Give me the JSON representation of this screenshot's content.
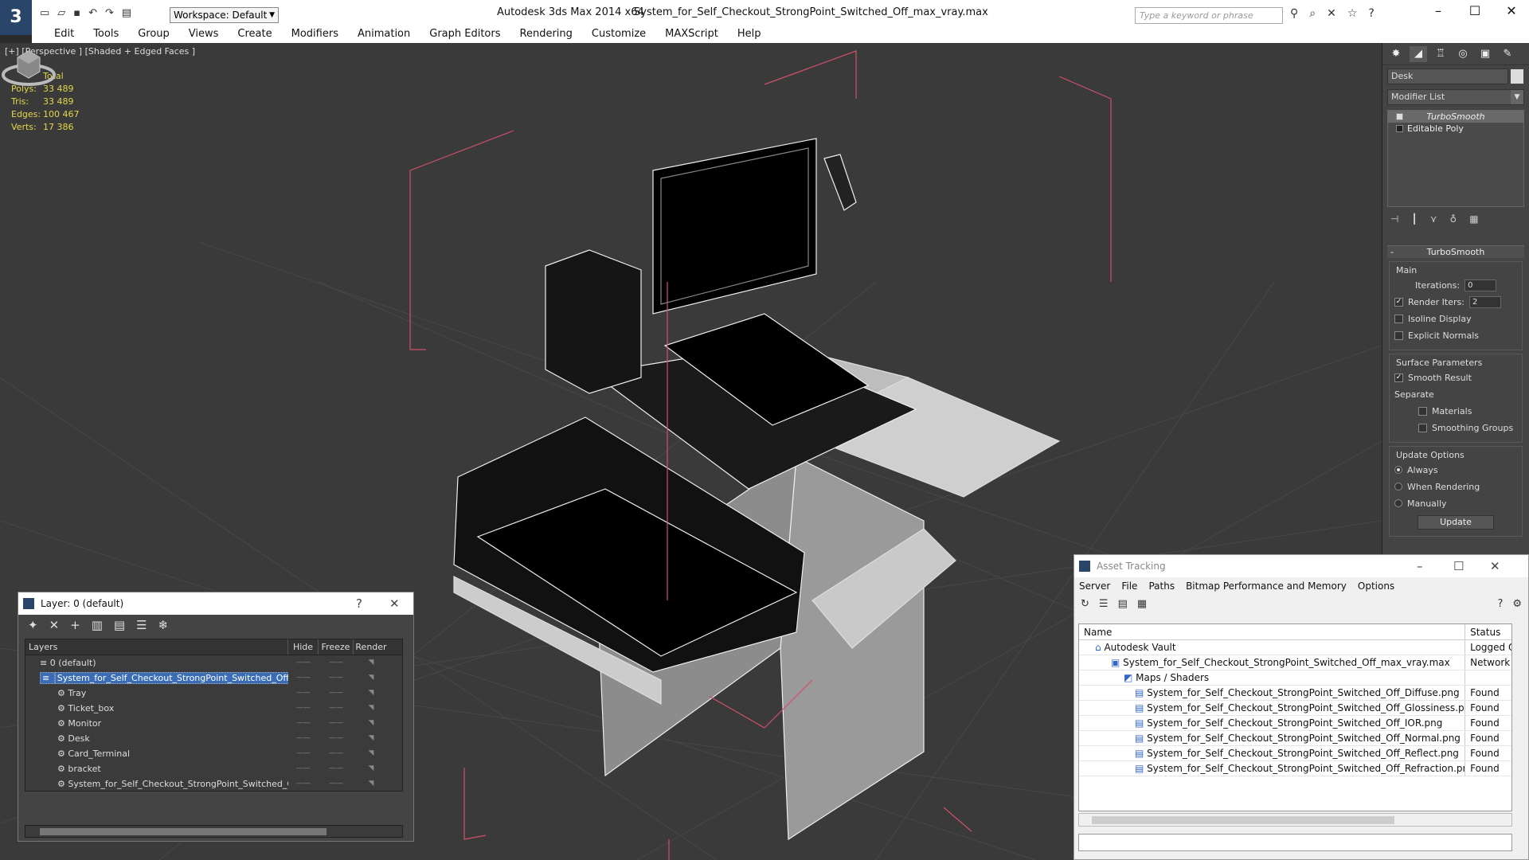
{
  "app": {
    "title": "Autodesk 3ds Max  2014 x64",
    "file": "System_for_Self_Checkout_StrongPoint_Switched_Off_max_vray.max",
    "workspace": "Workspace: Default",
    "search_placeholder": "Type a keyword or phrase"
  },
  "menu": [
    "Edit",
    "Tools",
    "Group",
    "Views",
    "Create",
    "Modifiers",
    "Animation",
    "Graph Editors",
    "Rendering",
    "Customize",
    "MAXScript",
    "Help"
  ],
  "viewport": {
    "label": "[+] [Perspective ] [Shaded + Edged Faces ]",
    "stats": {
      "header": "Total",
      "rows": [
        {
          "k": "Polys:",
          "v": "33 489"
        },
        {
          "k": "Tris:",
          "v": "33 489"
        },
        {
          "k": "Edges:",
          "v": "100 467"
        },
        {
          "k": "Verts:",
          "v": "17 386"
        }
      ]
    }
  },
  "command_panel": {
    "object_name": "Desk",
    "modifier_list": "Modifier List",
    "stack": [
      "TurboSmooth",
      "Editable Poly"
    ],
    "rollout": "TurboSmooth",
    "main_group": "Main",
    "iterations_label": "Iterations:",
    "iterations_value": "0",
    "render_iters_label": "Render Iters:",
    "render_iters_value": "2",
    "isoline": "Isoline Display",
    "explicit": "Explicit Normals",
    "surface_group": "Surface Parameters",
    "smooth_result": "Smooth Result",
    "separate": "Separate",
    "materials": "Materials",
    "smoothing_groups": "Smoothing Groups",
    "update_group": "Update Options",
    "always": "Always",
    "when_rendering": "When Rendering",
    "manually": "Manually",
    "update_btn": "Update"
  },
  "layer_window": {
    "title": "Layer: 0 (default)",
    "help": "?",
    "cols": {
      "layers": "Layers",
      "hide": "Hide",
      "freeze": "Freeze",
      "render": "Render"
    },
    "rows": [
      "0 (default)",
      "System_for_Self_Checkout_StrongPoint_Switched_Off",
      "Tray",
      "Ticket_box",
      "Monitor",
      "Desk",
      "Card_Terminal",
      "bracket",
      "System_for_Self_Checkout_StrongPoint_Switched_Off"
    ]
  },
  "asset_window": {
    "title": "Asset Tracking",
    "menu": [
      "Server",
      "File",
      "Paths",
      "Bitmap Performance and Memory",
      "Options"
    ],
    "cols": {
      "name": "Name",
      "status": "Status"
    },
    "rows": [
      {
        "name": "Autodesk Vault",
        "status": "Logged O"
      },
      {
        "name": "System_for_Self_Checkout_StrongPoint_Switched_Off_max_vray.max",
        "status": "Network I"
      },
      {
        "name": "Maps / Shaders",
        "status": ""
      },
      {
        "name": "System_for_Self_Checkout_StrongPoint_Switched_Off_Diffuse.png",
        "status": "Found"
      },
      {
        "name": "System_for_Self_Checkout_StrongPoint_Switched_Off_Glossiness.png",
        "status": "Found"
      },
      {
        "name": "System_for_Self_Checkout_StrongPoint_Switched_Off_IOR.png",
        "status": "Found"
      },
      {
        "name": "System_for_Self_Checkout_StrongPoint_Switched_Off_Normal.png",
        "status": "Found"
      },
      {
        "name": "System_for_Self_Checkout_StrongPoint_Switched_Off_Reflect.png",
        "status": "Found"
      },
      {
        "name": "System_for_Self_Checkout_StrongPoint_Switched_Off_Refraction.png",
        "status": "Found"
      }
    ]
  },
  "colors": {
    "accent": "#3a6db5",
    "stats": "#e6d64a",
    "bbox": "#d0506a"
  }
}
